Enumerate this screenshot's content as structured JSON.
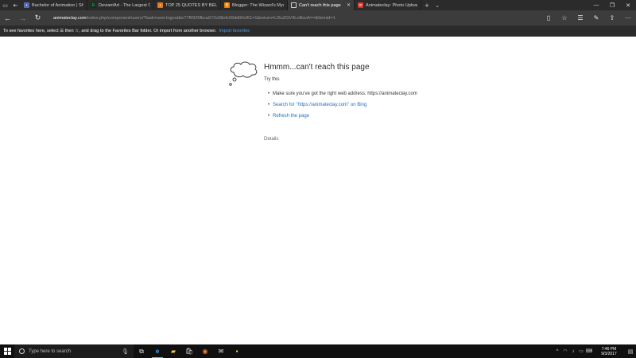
{
  "tabs": [
    {
      "title": "Bachelor of Animation | She",
      "favicon_color": "#5a6bb5",
      "active": false
    },
    {
      "title": "DeviantArt - The Largest Or",
      "favicon_color": "#05cc47",
      "active": false
    },
    {
      "title": "TOP 25 QUOTES BY BELA LU",
      "favicon_color": "#e07a1f",
      "active": false
    },
    {
      "title": "Blogger: The Wizard's Mysti",
      "favicon_color": "#f57d00",
      "active": false
    },
    {
      "title": "Can't reach this page",
      "favicon_color": "#cfcfcf",
      "active": true
    },
    {
      "title": "Animateclay: Photo Upload",
      "favicon_color": "#d93025",
      "active": false
    }
  ],
  "address": {
    "host": "animateclay.com",
    "path": "/index.php/component/users/?task=user.logout&e77f6925fbca672c08efc09dd00cf61=1&return=L2luZGV4LnBocA==&Itemid=1"
  },
  "favorites_bar": {
    "text": "To see favorites here, select ☰ then ☆, and drag to the Favorites Bar folder. Or import from another browser.",
    "link": "Import favorites"
  },
  "error_page": {
    "title": "Hmmm...can't reach this page",
    "try_this": "Try this",
    "bullet_check": "Make sure you've got the right web address: https://animateclay.com",
    "bullet_search": "Search for \"https://animateclay.com\" on Bing",
    "bullet_refresh": "Refresh the page",
    "details": "Details"
  },
  "taskbar": {
    "search_placeholder": "Type here to search",
    "time": "7:46 PM",
    "date": "9/3/2017"
  }
}
